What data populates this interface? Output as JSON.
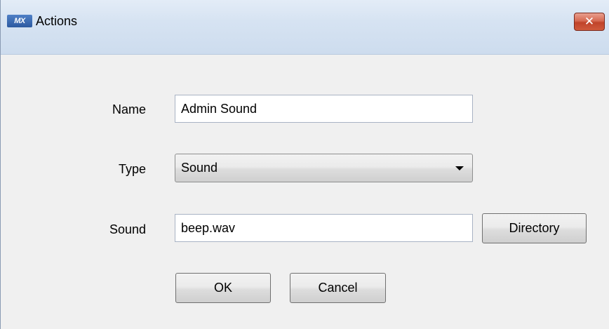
{
  "window": {
    "title": "Actions",
    "app_icon_text": "MX",
    "close_symbol": "✕"
  },
  "form": {
    "name_label": "Name",
    "name_value": "Admin Sound",
    "type_label": "Type",
    "type_value": "Sound",
    "sound_label": "Sound",
    "sound_value": "beep.wav",
    "directory_button": "Directory",
    "ok_button": "OK",
    "cancel_button": "Cancel"
  },
  "colors": {
    "titlebar": "#d6e3f2",
    "content_background": "#f0f0f0",
    "close_button": "#c0432a"
  }
}
